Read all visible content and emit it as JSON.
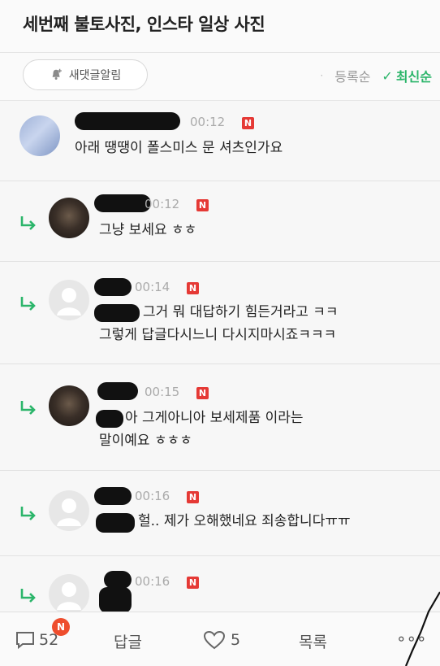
{
  "header": {
    "title": "세번째 불토사진, 인스타 일상 사진"
  },
  "toolbar": {
    "notify_label": "새댓글알림",
    "sort_options": [
      "등록순",
      "최신순"
    ],
    "active_sort": "최신순",
    "accent_color": "#2bb56a"
  },
  "comments": [
    {
      "time": "00:12",
      "badge": "N",
      "lines": [
        "아래 땡땡이 폴스미스 문 셔츠인가요"
      ],
      "avatar": "photo-blue",
      "reply": false
    },
    {
      "time": "00:12",
      "badge": "N",
      "lines": [
        "그냥 보세요 ㅎㅎ"
      ],
      "avatar": "photo-dark",
      "reply": true
    },
    {
      "time": "00:14",
      "badge": "N",
      "lines": [
        "그거 뭐 대답하기 힘든거라고 ㅋㅋ",
        "그렇게 답글다시느니 다시지마시죠ㅋㅋㅋ"
      ],
      "avatar": "default",
      "reply": true
    },
    {
      "time": "00:15",
      "badge": "N",
      "lines": [
        "아 그게아니아 보세제품 이라는",
        "말이예요 ㅎㅎㅎ"
      ],
      "avatar": "photo-dark",
      "reply": true
    },
    {
      "time": "00:16",
      "badge": "N",
      "lines": [
        "헐.. 제가 오해했네요 죄송합니다ㅠㅠ"
      ],
      "avatar": "default",
      "reply": true
    },
    {
      "time": "00:16",
      "badge": "N",
      "lines": [],
      "avatar": "default",
      "reply": true
    }
  ],
  "bottom_bar": {
    "comment_count": "52",
    "comment_badge": "N",
    "reply_label": "답글",
    "like_count": "5",
    "list_label": "목록",
    "more_label": "∘∘∘"
  }
}
